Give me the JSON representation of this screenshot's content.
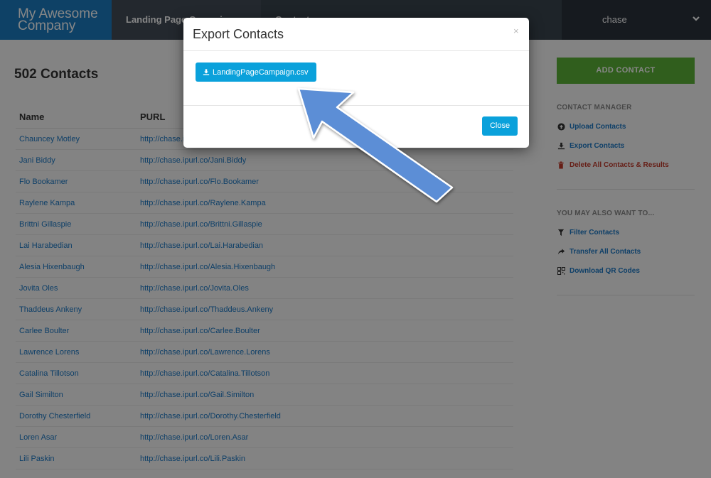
{
  "brand": {
    "line1": "My Awesome",
    "line2": "Company"
  },
  "nav": {
    "tab1": "Landing Page Campaign",
    "tab2": "Contacts",
    "user": "chase"
  },
  "contacts": {
    "title": "502 Contacts",
    "columns": [
      "Name",
      "PURL"
    ],
    "rows": [
      {
        "name": "Chauncey Motley",
        "purl": "http://chase.ipurl.co/Chauncey.Motley"
      },
      {
        "name": "Jani Biddy",
        "purl": "http://chase.ipurl.co/Jani.Biddy"
      },
      {
        "name": "Flo Bookamer",
        "purl": "http://chase.ipurl.co/Flo.Bookamer"
      },
      {
        "name": "Raylene Kampa",
        "purl": "http://chase.ipurl.co/Raylene.Kampa"
      },
      {
        "name": "Brittni Gillaspie",
        "purl": "http://chase.ipurl.co/Brittni.Gillaspie"
      },
      {
        "name": "Lai Harabedian",
        "purl": "http://chase.ipurl.co/Lai.Harabedian"
      },
      {
        "name": "Alesia Hixenbaugh",
        "purl": "http://chase.ipurl.co/Alesia.Hixenbaugh"
      },
      {
        "name": "Jovita Oles",
        "purl": "http://chase.ipurl.co/Jovita.Oles"
      },
      {
        "name": "Thaddeus Ankeny",
        "purl": "http://chase.ipurl.co/Thaddeus.Ankeny"
      },
      {
        "name": "Carlee Boulter",
        "purl": "http://chase.ipurl.co/Carlee.Boulter"
      },
      {
        "name": "Lawrence Lorens",
        "purl": "http://chase.ipurl.co/Lawrence.Lorens"
      },
      {
        "name": "Catalina Tillotson",
        "purl": "http://chase.ipurl.co/Catalina.Tillotson"
      },
      {
        "name": "Gail Similton",
        "purl": "http://chase.ipurl.co/Gail.Similton"
      },
      {
        "name": "Dorothy Chesterfield",
        "purl": "http://chase.ipurl.co/Dorothy.Chesterfield"
      },
      {
        "name": "Loren Asar",
        "purl": "http://chase.ipurl.co/Loren.Asar"
      },
      {
        "name": "Lili Paskin",
        "purl": "http://chase.ipurl.co/Lili.Paskin"
      }
    ]
  },
  "sidebar": {
    "add_button": "ADD CONTACT",
    "manager_heading": "CONTACT MANAGER",
    "manager_items": [
      {
        "label": "Upload Contacts",
        "icon": "upload-circle-icon"
      },
      {
        "label": "Export Contacts",
        "icon": "download-icon"
      },
      {
        "label": "Delete All Contacts & Results",
        "icon": "trash-icon"
      }
    ],
    "also_heading": "YOU MAY ALSO WANT TO...",
    "also_items": [
      {
        "label": "Filter Contacts",
        "icon": "filter-icon"
      },
      {
        "label": "Transfer All Contacts",
        "icon": "share-arrow-icon"
      },
      {
        "label": "Download QR Codes",
        "icon": "qr-code-icon"
      }
    ]
  },
  "modal": {
    "title": "Export Contacts",
    "close_x": "×",
    "file_button": "LandingPageCampaign.csv",
    "close_button": "Close"
  },
  "colors": {
    "brand_blue": "#1b7bc0",
    "button_blue": "#0aa1db",
    "add_green": "#5cb138",
    "link_blue": "#1b78c4",
    "annotation_arrow": "#5b8ed6"
  }
}
